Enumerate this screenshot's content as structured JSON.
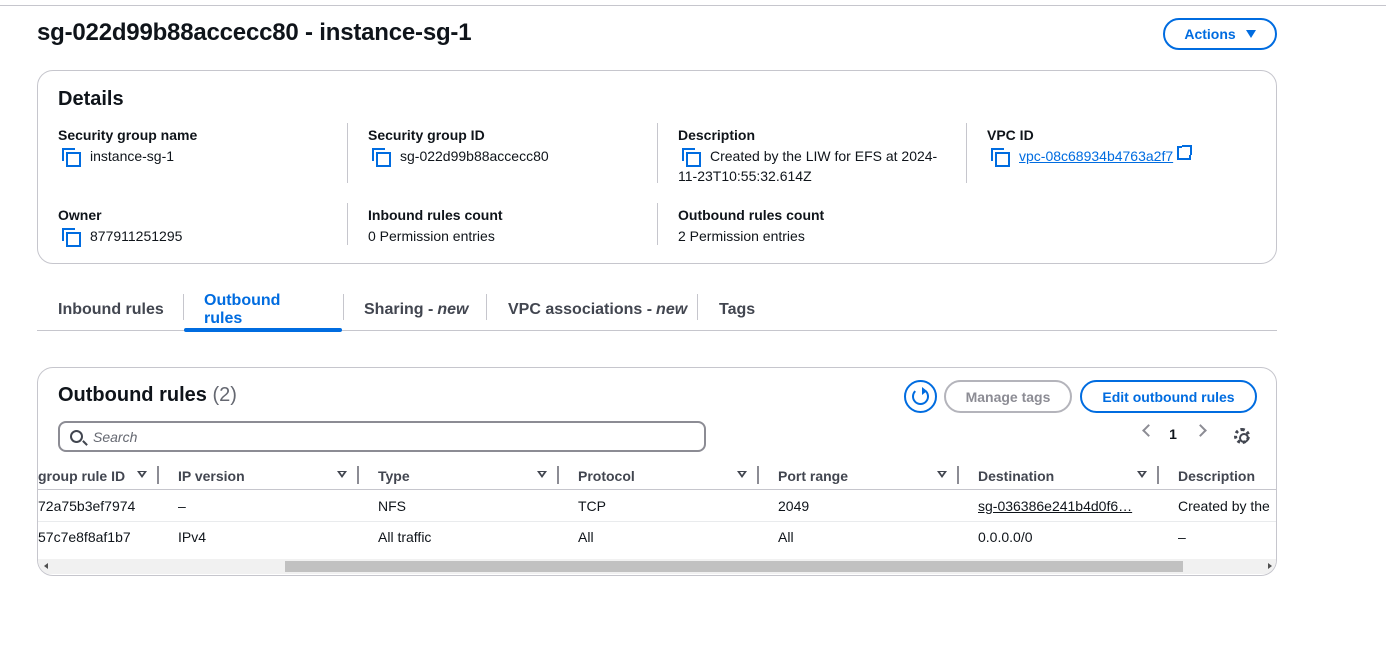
{
  "page": {
    "title": "sg-022d99b88accecc80 - instance-sg-1",
    "actions_label": "Actions"
  },
  "details": {
    "heading": "Details",
    "security_group_name": {
      "label": "Security group name",
      "value": "instance-sg-1"
    },
    "security_group_id": {
      "label": "Security group ID",
      "value": "sg-022d99b88accecc80"
    },
    "description": {
      "label": "Description",
      "value": "Created by the LIW for EFS at 2024-11-23T10:55:32.614Z"
    },
    "vpc_id": {
      "label": "VPC ID",
      "value": "vpc-08c68934b4763a2f7"
    },
    "owner": {
      "label": "Owner",
      "value": "877911251295"
    },
    "inbound_rules_count": {
      "label": "Inbound rules count",
      "value": "0 Permission entries"
    },
    "outbound_rules_count": {
      "label": "Outbound rules count",
      "value": "2 Permission entries"
    }
  },
  "tabs": [
    {
      "label": "Inbound rules",
      "suffix": ""
    },
    {
      "label": "Outbound rules",
      "suffix": ""
    },
    {
      "label": "Sharing -",
      "suffix": "new"
    },
    {
      "label": "VPC associations -",
      "suffix": "new"
    },
    {
      "label": "Tags",
      "suffix": ""
    }
  ],
  "outbound": {
    "heading": "Outbound rules",
    "count": "(2)",
    "manage_tags_label": "Manage tags",
    "edit_label": "Edit outbound rules",
    "search_placeholder": "Search",
    "page_number": "1",
    "columns": [
      "group rule ID",
      "IP version",
      "Type",
      "Protocol",
      "Port range",
      "Destination",
      "Description"
    ],
    "rows": [
      {
        "rule_id": "72a75b3ef7974",
        "ip_version": "–",
        "type": "NFS",
        "protocol": "TCP",
        "port_range": "2049",
        "destination": "sg-036386e241b4d0f6…",
        "description": "Created by the"
      },
      {
        "rule_id": "57c7e8f8af1b7",
        "ip_version": "IPv4",
        "type": "All traffic",
        "protocol": "All",
        "port_range": "All",
        "destination": "0.0.0.0/0",
        "description": "–"
      }
    ]
  },
  "colors": {
    "accent": "#006ce0",
    "border": "#c6c6cd",
    "text": "#0f141a"
  }
}
